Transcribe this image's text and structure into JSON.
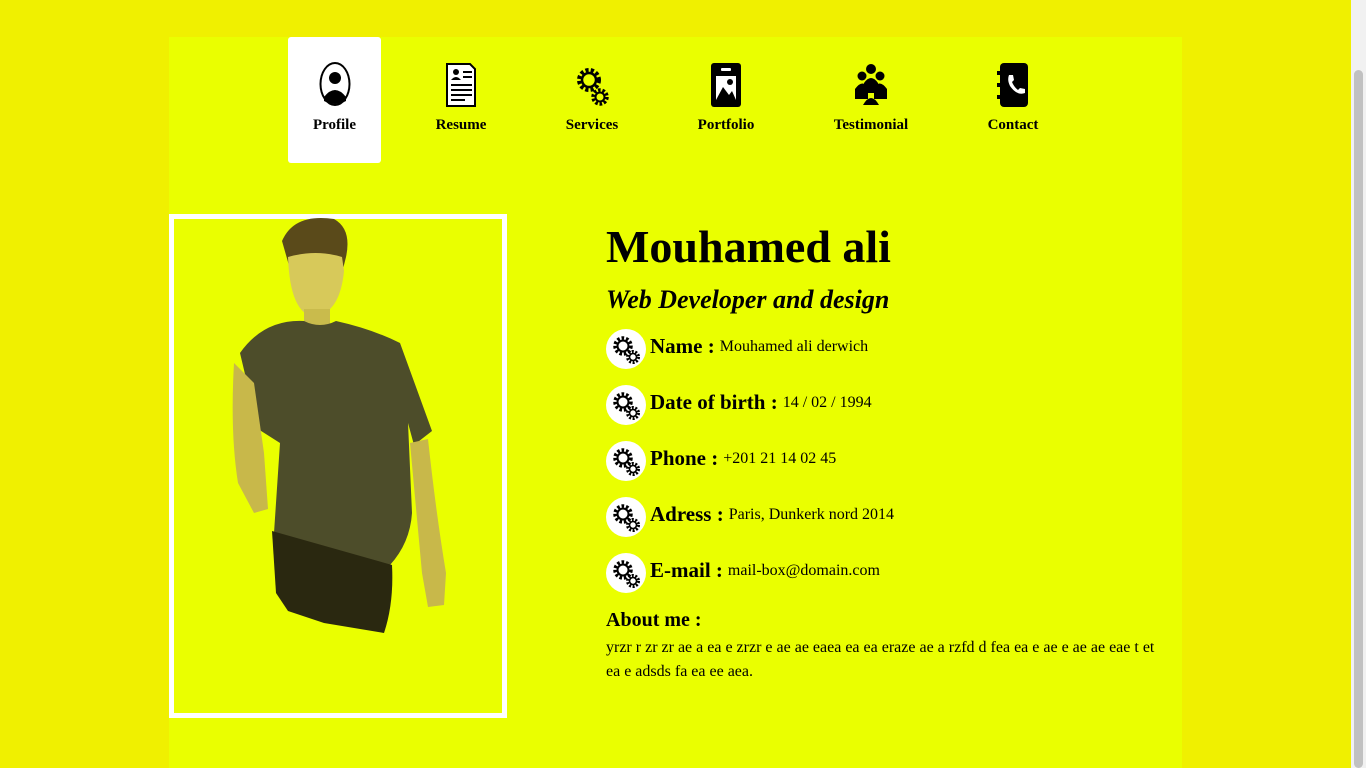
{
  "nav": {
    "items": [
      {
        "label": "Profile",
        "icon": "profile-icon",
        "active": true
      },
      {
        "label": "Resume",
        "icon": "resume-icon"
      },
      {
        "label": "Services",
        "icon": "gears-icon"
      },
      {
        "label": "Portfolio",
        "icon": "portfolio-icon"
      },
      {
        "label": "Testimonial",
        "icon": "people-icon"
      },
      {
        "label": "Contact",
        "icon": "phone-book-icon"
      }
    ]
  },
  "profile": {
    "name": "Mouhamed ali",
    "title": "Web Developer and design",
    "fields": [
      {
        "label": "Name :",
        "value": "Mouhamed ali derwich"
      },
      {
        "label": "Date of birth :",
        "value": "14 / 02 / 1994"
      },
      {
        "label": "Phone :",
        "value": "+201 21 14 02 45"
      },
      {
        "label": "Adress :",
        "value": "Paris, Dunkerk nord 2014"
      },
      {
        "label": "E-mail :",
        "value": "mail-box@domain.com"
      }
    ],
    "about_heading": "About me :",
    "about_text": "yrzr r zr zr ae a ea e zrzr e ae ae eaea ea ea eraze ae a rzfd d fea ea e ae e ae ae eae t et ea e adsds fa ea ee aea."
  },
  "colors": {
    "background": "#f0f000",
    "panel": "#eaff00",
    "active_tab": "#ffffff"
  }
}
